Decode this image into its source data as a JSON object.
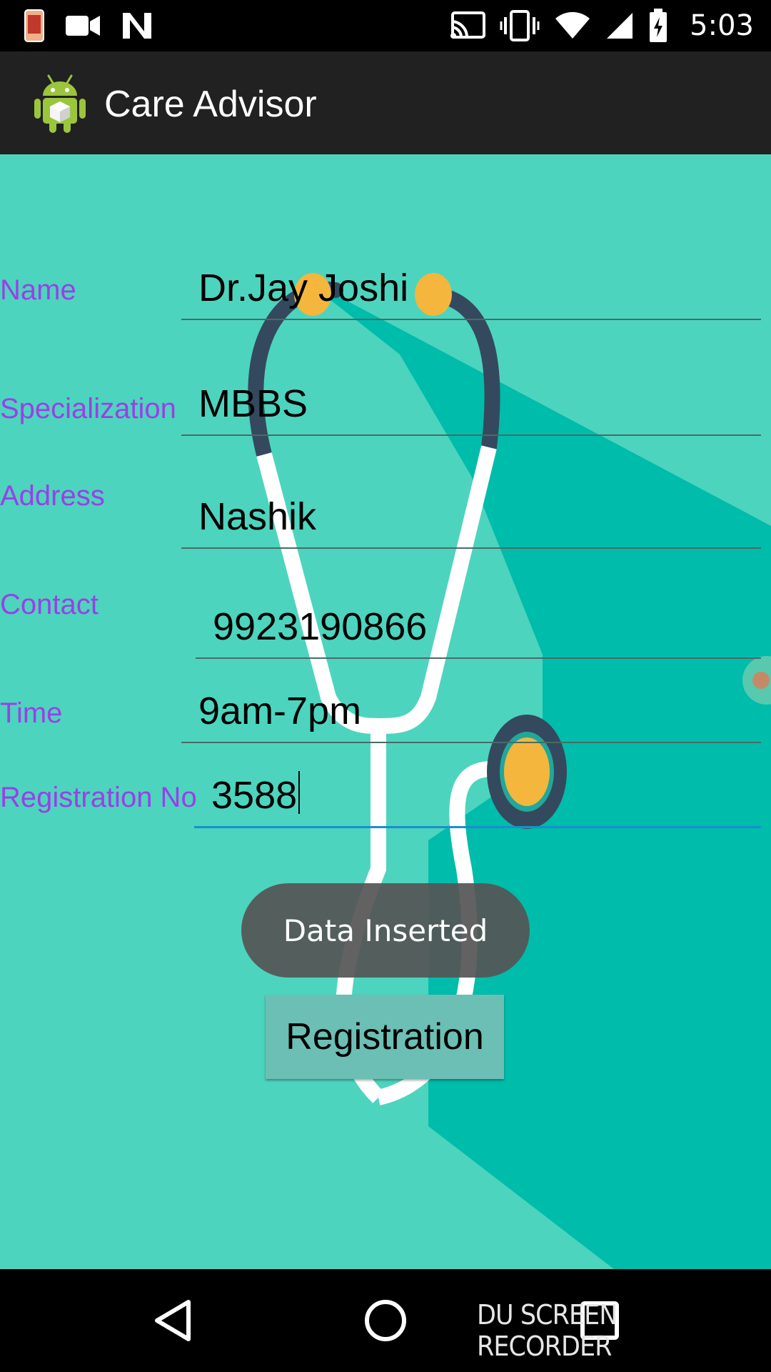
{
  "status_bar": {
    "time": "5:03",
    "icons": [
      "notification-app-icon",
      "video-camera-icon",
      "n-icon",
      "cast-icon",
      "vibrate-icon",
      "wifi-icon",
      "signal-icon",
      "battery-charging-icon"
    ]
  },
  "app_bar": {
    "title": "Care Advisor",
    "logo_icon": "android-icon"
  },
  "form": {
    "fields": [
      {
        "label": "Name",
        "value": "Dr.Jay Joshi"
      },
      {
        "label": "Specialization",
        "value": "MBBS"
      },
      {
        "label": "Address",
        "value": "Nashik"
      },
      {
        "label": "Contact",
        "value": "9923190866"
      },
      {
        "label": "Time",
        "value": "9am-7pm"
      },
      {
        "label": "Registration No",
        "value": "3588"
      }
    ]
  },
  "toast": {
    "text": "Data Inserted"
  },
  "register_button": {
    "label": "Registration"
  },
  "nav_bar": {
    "icons": [
      "back-icon",
      "home-icon",
      "recents-icon"
    ]
  },
  "watermark": {
    "text": "DU SCREEN RECORDER"
  },
  "colors": {
    "background": "#4dd4be",
    "shadow": "#00bcab",
    "label": "#9b3fe6",
    "app_bar": "#212121",
    "stethoscope_dark": "#34495e",
    "stethoscope_accent": "#f4b63d"
  }
}
